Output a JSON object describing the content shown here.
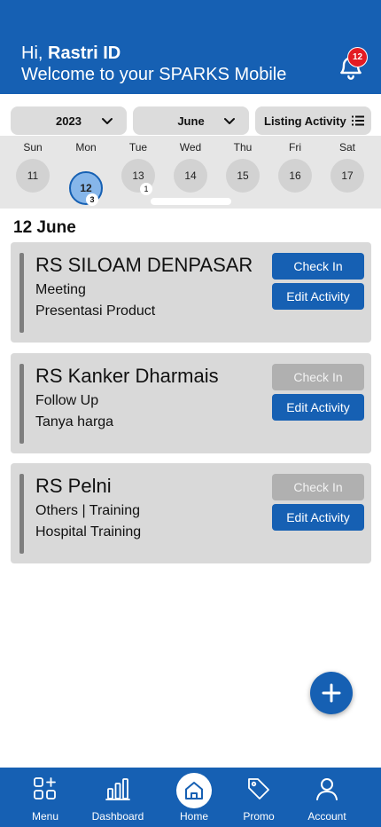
{
  "header": {
    "greeting_prefix": "Hi, ",
    "user_name": "Rastri ID",
    "welcome": "Welcome to your SPARKS Mobile",
    "notification_count": "12"
  },
  "filters": {
    "year": "2023",
    "month": "June",
    "view": "Listing Activity"
  },
  "week": {
    "days": [
      {
        "name": "Sun",
        "num": "11",
        "badge": ""
      },
      {
        "name": "Mon",
        "num": "12",
        "badge": "3",
        "selected": true
      },
      {
        "name": "Tue",
        "num": "13",
        "badge": "1"
      },
      {
        "name": "Wed",
        "num": "14",
        "badge": ""
      },
      {
        "name": "Thu",
        "num": "15",
        "badge": ""
      },
      {
        "name": "Fri",
        "num": "16",
        "badge": ""
      },
      {
        "name": "Sat",
        "num": "17",
        "badge": ""
      }
    ]
  },
  "date_heading": "12 June",
  "activities": [
    {
      "title": "RS SILOAM DENPASAR",
      "type": "Meeting",
      "description": "Presentasi Product",
      "checkin_label": "Check In",
      "checkin_enabled": true,
      "edit_label": "Edit Activity"
    },
    {
      "title": "RS Kanker Dharmais",
      "type": "Follow Up",
      "description": "Tanya harga",
      "checkin_label": "Check In",
      "checkin_enabled": false,
      "edit_label": "Edit Activity"
    },
    {
      "title": "RS Pelni",
      "type": "Others | Training",
      "description": "Hospital Training",
      "checkin_label": "Check In",
      "checkin_enabled": false,
      "edit_label": "Edit Activity"
    }
  ],
  "nav": {
    "items": [
      {
        "label": "Menu",
        "icon": "grid-plus-icon"
      },
      {
        "label": "Dashboard",
        "icon": "bar-chart-icon"
      },
      {
        "label": "Home",
        "icon": "home-icon",
        "active": true
      },
      {
        "label": "Promo",
        "icon": "tag-icon"
      },
      {
        "label": "Account",
        "icon": "user-icon"
      }
    ]
  },
  "colors": {
    "primary": "#1660b3",
    "badge": "#e31b23",
    "card": "#d9d9d9",
    "selected_day": "#86b6ea",
    "disabled_button": "#b0b0b0"
  }
}
